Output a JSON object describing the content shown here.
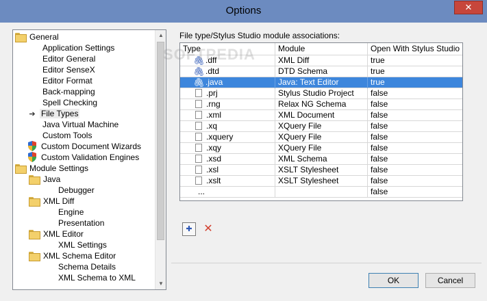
{
  "window": {
    "title": "Options",
    "close_glyph": "✕"
  },
  "watermark": "SOFTPEDIA",
  "tree": {
    "items": [
      {
        "label": "General",
        "icon": "folder-icon",
        "level": 0
      },
      {
        "label": "Application Settings",
        "icon": "",
        "level": 2
      },
      {
        "label": "Editor General",
        "icon": "",
        "level": 2
      },
      {
        "label": "Editor SenseX",
        "icon": "",
        "level": 2
      },
      {
        "label": "Editor Format",
        "icon": "",
        "level": 2
      },
      {
        "label": "Back-mapping",
        "icon": "",
        "level": 2
      },
      {
        "label": "Spell Checking",
        "icon": "",
        "level": 2
      },
      {
        "label": "File Types",
        "icon": "arrow-icon",
        "level": 2,
        "selected": true
      },
      {
        "label": "Java Virtual Machine",
        "icon": "",
        "level": 2
      },
      {
        "label": "Custom Tools",
        "icon": "",
        "level": 2
      },
      {
        "label": "Custom Document Wizards",
        "icon": "shield-icon",
        "level": 2
      },
      {
        "label": "Custom Validation Engines",
        "icon": "shield-icon",
        "level": 2
      },
      {
        "label": "Module Settings",
        "icon": "folder-icon",
        "level": 0
      },
      {
        "label": "Java",
        "icon": "folder-icon",
        "level": 1
      },
      {
        "label": "Debugger",
        "icon": "",
        "level": 3
      },
      {
        "label": "XML Diff",
        "icon": "folder-icon",
        "level": 1
      },
      {
        "label": "Engine",
        "icon": "",
        "level": 3
      },
      {
        "label": "Presentation",
        "icon": "",
        "level": 3
      },
      {
        "label": "XML Editor",
        "icon": "folder-icon",
        "level": 1
      },
      {
        "label": "XML Settings",
        "icon": "",
        "level": 3
      },
      {
        "label": "XML Schema Editor",
        "icon": "folder-icon",
        "level": 1
      },
      {
        "label": "Schema Details",
        "icon": "",
        "level": 3
      },
      {
        "label": "XML Schema to XML",
        "icon": "",
        "level": 3
      }
    ]
  },
  "associations": {
    "label": "File type/Stylus Studio module associations:",
    "columns": [
      "Type",
      "Module",
      "Open With Stylus Studio"
    ],
    "rows": [
      {
        "type": ".dff",
        "module": "XML Diff",
        "open": "true",
        "icon": "clip-icon"
      },
      {
        "type": ".dtd",
        "module": "DTD Schema",
        "open": "true",
        "icon": "clip-icon"
      },
      {
        "type": ".java",
        "module": "Java: Text Editor",
        "open": "true",
        "icon": "clip-icon",
        "selected": true
      },
      {
        "type": ".prj",
        "module": "Stylus Studio Project",
        "open": "false",
        "icon": "file-icon"
      },
      {
        "type": ".rng",
        "module": "Relax NG Schema",
        "open": "false",
        "icon": "file-icon"
      },
      {
        "type": ".xml",
        "module": "XML Document",
        "open": "false",
        "icon": "file-icon"
      },
      {
        "type": ".xq",
        "module": "XQuery File",
        "open": "false",
        "icon": "file-icon"
      },
      {
        "type": ".xquery",
        "module": "XQuery File",
        "open": "false",
        "icon": "file-icon"
      },
      {
        "type": ".xqy",
        "module": "XQuery File",
        "open": "false",
        "icon": "file-icon"
      },
      {
        "type": ".xsd",
        "module": "XML Schema",
        "open": "false",
        "icon": "file-icon"
      },
      {
        "type": ".xsl",
        "module": "XSLT Stylesheet",
        "open": "false",
        "icon": "file-icon"
      },
      {
        "type": ".xslt",
        "module": "XSLT Stylesheet",
        "open": "false",
        "icon": "file-icon"
      },
      {
        "type": "...",
        "module": "",
        "open": "false",
        "icon": ""
      }
    ]
  },
  "toolbar": {
    "new_glyph": "✚",
    "delete_glyph": "✕"
  },
  "buttons": {
    "ok": "OK",
    "cancel": "Cancel"
  },
  "colors": {
    "titlebar": "#6c8bc0",
    "selection": "#3d86dc",
    "close": "#c7463b"
  }
}
